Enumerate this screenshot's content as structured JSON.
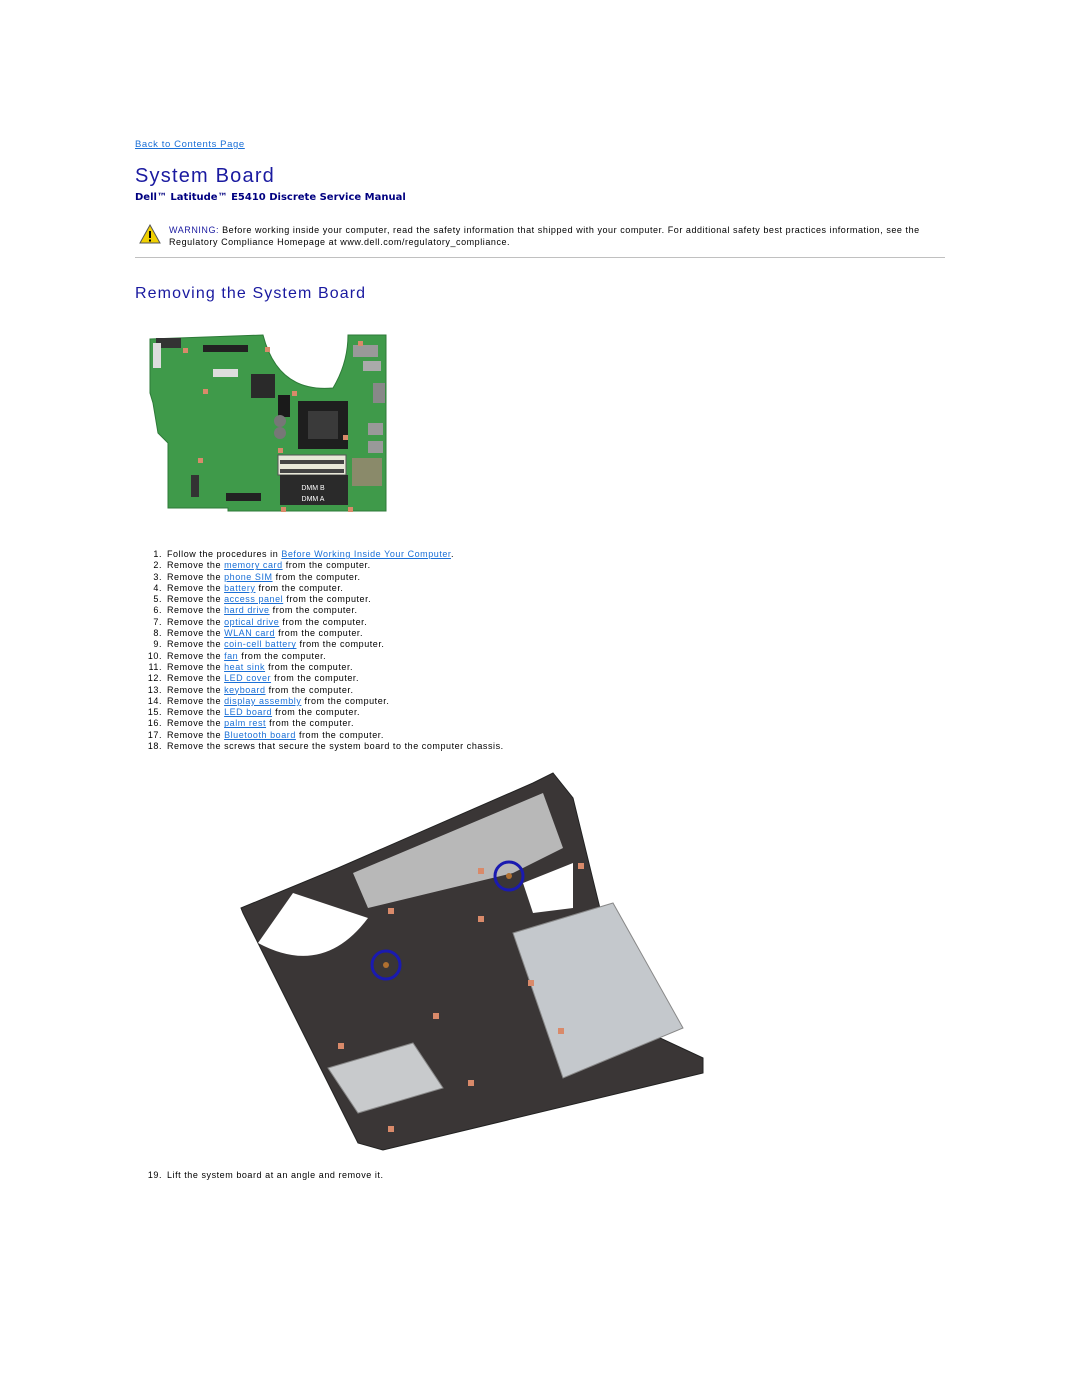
{
  "nav": {
    "back_link": "Back to Contents Page"
  },
  "header": {
    "title": "System Board",
    "subtitle": "Dell™ Latitude™ E5410 Discrete Service Manual"
  },
  "warning": {
    "icon": "warning-triangle-icon",
    "label": "WARNING:",
    "text": " Before working inside your computer, read the safety information that shipped with your computer. For additional safety best practices information, see the Regulatory Compliance Homepage at www.dell.com/regulatory_compliance."
  },
  "section": {
    "title": "Removing the System Board",
    "images": {
      "board": {
        "alt": "System board with DMM B and DMM A memory slots",
        "labels": [
          "DMM B",
          "DMM A"
        ]
      },
      "chassis": {
        "alt": "System board in computer chassis with two screws circled"
      }
    },
    "steps": [
      {
        "num": "1.",
        "pre": "Follow the procedures in ",
        "link": "Before Working Inside Your Computer",
        "post": "."
      },
      {
        "num": "2.",
        "pre": "Remove the ",
        "link": "memory card",
        "post": " from the computer."
      },
      {
        "num": "3.",
        "pre": "Remove the ",
        "link": "phone SIM",
        "post": " from the computer."
      },
      {
        "num": "4.",
        "pre": "Remove the ",
        "link": "battery",
        "post": " from the computer."
      },
      {
        "num": "5.",
        "pre": "Remove the ",
        "link": "access panel",
        "post": " from the computer."
      },
      {
        "num": "6.",
        "pre": "Remove the ",
        "link": "hard drive",
        "post": " from the computer."
      },
      {
        "num": "7.",
        "pre": "Remove the ",
        "link": "optical drive",
        "post": " from the computer."
      },
      {
        "num": "8.",
        "pre": "Remove the ",
        "link": "WLAN card",
        "post": " from the computer."
      },
      {
        "num": "9.",
        "pre": "Remove the ",
        "link": "coin-cell battery",
        "post": " from the computer."
      },
      {
        "num": "10.",
        "pre": "Remove the ",
        "link": "fan",
        "post": " from the computer."
      },
      {
        "num": "11.",
        "pre": "Remove the ",
        "link": "heat sink",
        "post": " from the computer."
      },
      {
        "num": "12.",
        "pre": "Remove the ",
        "link": "LED cover",
        "post": " from the computer."
      },
      {
        "num": "13.",
        "pre": "Remove the ",
        "link": "keyboard",
        "post": " from the computer."
      },
      {
        "num": "14.",
        "pre": "Remove the ",
        "link": "display assembly",
        "post": " from the computer."
      },
      {
        "num": "15.",
        "pre": "Remove the ",
        "link": "LED board",
        "post": " from the computer."
      },
      {
        "num": "16.",
        "pre": "Remove the ",
        "link": "palm rest",
        "post": " from the computer."
      },
      {
        "num": "17.",
        "pre": "Remove the ",
        "link": "Bluetooth board",
        "post": " from the computer."
      },
      {
        "num": "18.",
        "pre": "Remove the screws that secure the system board to the computer chassis.",
        "link": "",
        "post": ""
      }
    ],
    "final_step": {
      "num": "19.",
      "text": "Lift the system board at an angle and remove it."
    }
  },
  "colors": {
    "heading": "#1a1aa0",
    "subtitle": "#000080",
    "link": "#1a6fd6",
    "separator": "#c0c0c0",
    "warning_icon": "#e8c800"
  }
}
